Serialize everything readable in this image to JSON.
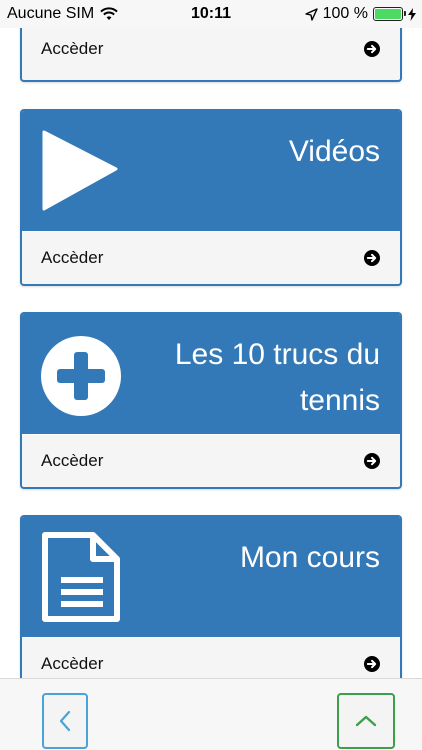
{
  "status_bar": {
    "carrier": "Aucune SIM",
    "time": "10:11",
    "battery": "100 %"
  },
  "cards": [
    {
      "title": "",
      "action": "Accèder"
    },
    {
      "title": "Vidéos",
      "icon": "play-icon",
      "action": "Accèder"
    },
    {
      "title": "Les 10 trucs du tennis",
      "icon": "plus-circle-icon",
      "action": "Accèder"
    },
    {
      "title": "Mon cours",
      "icon": "document-icon",
      "action": "Accèder"
    }
  ],
  "bottom_nav": {
    "back_icon": "chevron-left-icon",
    "up_icon": "chevron-up-icon"
  },
  "colors": {
    "card_header": "#3479b7",
    "back_button_border": "#4aa3d8",
    "up_button_border": "#3ca04a"
  }
}
